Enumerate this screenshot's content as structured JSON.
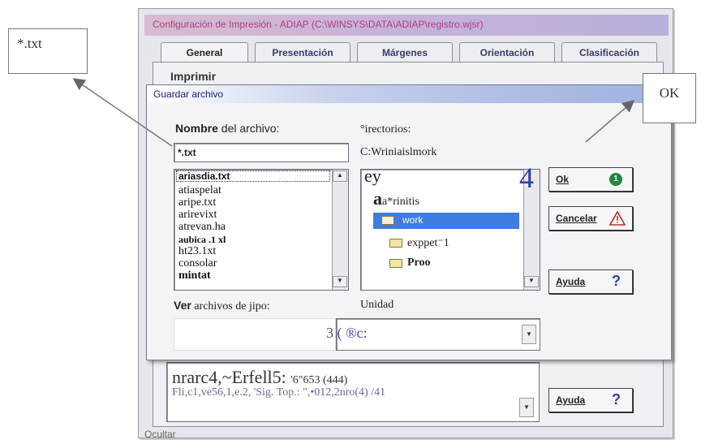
{
  "callouts": {
    "txt": "*.txt",
    "ok": "OK"
  },
  "outer_window": {
    "title": "Configuración de Impresión - ADIAP (C:\\WINSYS\\DATA\\ADIAP\\registro.wjsr)",
    "tabs": [
      "General",
      "Presentación",
      "Márgenes",
      "Orientación",
      "Clasificación"
    ],
    "section_label": "Imprimir",
    "bottom_text_1": "nrarc4,~Erfell5:",
    "bottom_text_1b": "'6\"653 (444)",
    "bottom_text_2": "Fli,c1,ve56,1,e.2, 'Sig. Top.: \",•012,2nro(4) /41",
    "bottom_button": "Ayuda",
    "bottom_button_glyph": "?",
    "footer_text": "Ocultar"
  },
  "dialog": {
    "title": "Guardar archivo",
    "name_label_bold": "Nombre",
    "name_label_rest": " del archivo:",
    "name_value": "*.txt",
    "files": [
      "ariasdia.txt",
      "atiaspelat",
      "aripe.txt",
      "arirevixt",
      "atrevan.ha",
      "aubica .1 xl",
      "ht23.1xt",
      "consolar",
      "mintat"
    ],
    "dirs_label": "°irectorios:",
    "dir_path": "C:Wriniaislmork",
    "dirs": [
      "ey",
      "a*rinitis",
      "work",
      "exppet⁻1",
      "Proo"
    ],
    "big_number": "4",
    "type_label_bold": "Ver",
    "type_label_rest": " archivos de jipo:",
    "drive_label": "Unidad",
    "drive_value": "3 ( ®c:",
    "buttons": {
      "ok": "Ok",
      "cancel": "Cancelar",
      "help": "Ayuda"
    },
    "button_glyphs": {
      "ok": "1",
      "cancel": "!",
      "help": "?"
    }
  },
  "colors": {
    "accent": "#3d7de0",
    "ok_green": "#1e8a3a",
    "help_blue": "#2b3fb0",
    "warn_red": "#c0282a"
  }
}
